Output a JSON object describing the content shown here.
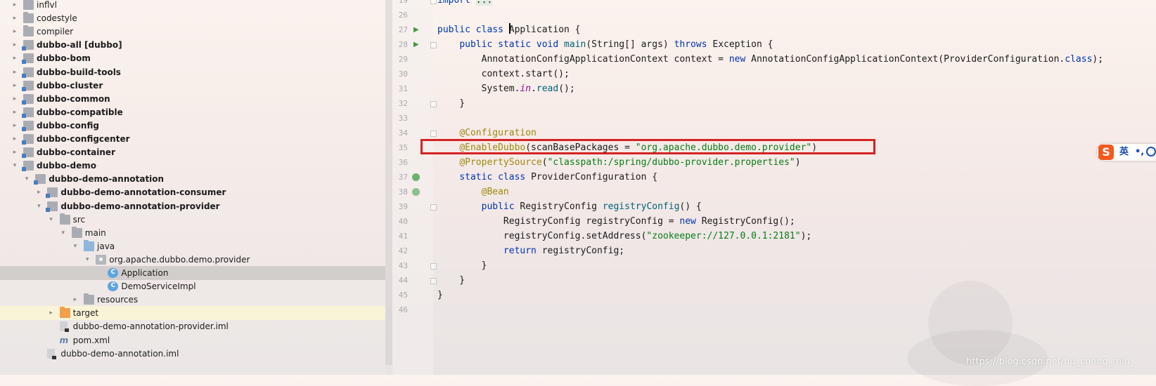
{
  "tree": {
    "rows": [
      {
        "indent": 1,
        "arrow": "▸",
        "icon": "folder",
        "label": "inflvl",
        "bold": false
      },
      {
        "indent": 1,
        "arrow": "▸",
        "icon": "folder",
        "label": "codestyle",
        "bold": false
      },
      {
        "indent": 1,
        "arrow": "▸",
        "icon": "folder",
        "label": "compiler",
        "bold": false
      },
      {
        "indent": 1,
        "arrow": "▸",
        "icon": "module",
        "label": "dubbo-all",
        "suffix": "[dubbo]",
        "bold": true
      },
      {
        "indent": 1,
        "arrow": "▸",
        "icon": "module",
        "label": "dubbo-bom",
        "bold": true
      },
      {
        "indent": 1,
        "arrow": "▸",
        "icon": "module",
        "label": "dubbo-build-tools",
        "bold": true
      },
      {
        "indent": 1,
        "arrow": "▸",
        "icon": "module",
        "label": "dubbo-cluster",
        "bold": true
      },
      {
        "indent": 1,
        "arrow": "▸",
        "icon": "module",
        "label": "dubbo-common",
        "bold": true
      },
      {
        "indent": 1,
        "arrow": "▸",
        "icon": "module",
        "label": "dubbo-compatible",
        "bold": true
      },
      {
        "indent": 1,
        "arrow": "▸",
        "icon": "module",
        "label": "dubbo-config",
        "bold": true
      },
      {
        "indent": 1,
        "arrow": "▸",
        "icon": "module",
        "label": "dubbo-configcenter",
        "bold": true
      },
      {
        "indent": 1,
        "arrow": "▸",
        "icon": "module",
        "label": "dubbo-container",
        "bold": true
      },
      {
        "indent": 1,
        "arrow": "▾",
        "icon": "module",
        "label": "dubbo-demo",
        "bold": true
      },
      {
        "indent": 2,
        "arrow": "▾",
        "icon": "module",
        "label": "dubbo-demo-annotation",
        "bold": true
      },
      {
        "indent": 3,
        "arrow": "▸",
        "icon": "module",
        "label": "dubbo-demo-annotation-consumer",
        "bold": true
      },
      {
        "indent": 3,
        "arrow": "▾",
        "icon": "module",
        "label": "dubbo-demo-annotation-provider",
        "bold": true
      },
      {
        "indent": 4,
        "arrow": "▾",
        "icon": "folder",
        "label": "src",
        "bold": false
      },
      {
        "indent": 5,
        "arrow": "▾",
        "icon": "folder",
        "label": "main",
        "bold": false
      },
      {
        "indent": 6,
        "arrow": "▾",
        "icon": "src-folder",
        "label": "java",
        "bold": false
      },
      {
        "indent": 7,
        "arrow": "▾",
        "icon": "package",
        "label": "org.apache.dubbo.demo.provider",
        "bold": false
      },
      {
        "indent": 8,
        "arrow": "",
        "icon": "class",
        "label": "Application",
        "bold": false,
        "selected": true
      },
      {
        "indent": 8,
        "arrow": "",
        "icon": "class",
        "label": "DemoServiceImpl",
        "bold": false
      },
      {
        "indent": 6,
        "arrow": "▸",
        "icon": "res-folder",
        "label": "resources",
        "bold": false
      },
      {
        "indent": 4,
        "arrow": "▸",
        "icon": "orange-folder",
        "label": "target",
        "bold": false,
        "target": true
      },
      {
        "indent": 4,
        "arrow": "",
        "icon": "iml",
        "label": "dubbo-demo-annotation-provider.iml",
        "bold": false
      },
      {
        "indent": 4,
        "arrow": "",
        "icon": "maven",
        "label": "pom.xml",
        "bold": false
      },
      {
        "indent": 3,
        "arrow": "",
        "icon": "iml",
        "label": "dubbo-demo-annotation.iml",
        "bold": false
      }
    ]
  },
  "editor": {
    "lines": [
      {
        "n": "19",
        "fold": true,
        "segs": [
          [
            "kw",
            "import "
          ],
          [
            "pill",
            "..."
          ]
        ]
      },
      {
        "n": "26",
        "segs": []
      },
      {
        "n": "27",
        "run": true,
        "segs": [
          [
            "kw",
            "public class "
          ],
          [
            "caret",
            ""
          ],
          [
            "",
            "Application {"
          ]
        ]
      },
      {
        "n": "28",
        "run": true,
        "fold": true,
        "segs": [
          [
            "",
            "    "
          ],
          [
            "kw",
            "public static void "
          ],
          [
            "mt",
            "main"
          ],
          [
            "",
            "(String[] args) "
          ],
          [
            "kw",
            "throws "
          ],
          [
            "",
            "Exception {"
          ]
        ]
      },
      {
        "n": "29",
        "segs": [
          [
            "",
            "        AnnotationConfigApplicationContext context = "
          ],
          [
            "kw",
            "new "
          ],
          [
            "",
            "AnnotationConfigApplicationContext(ProviderConfiguration."
          ],
          [
            "kw",
            "class"
          ],
          [
            "",
            ");"
          ]
        ]
      },
      {
        "n": "30",
        "segs": [
          [
            "",
            "        context.start();"
          ]
        ]
      },
      {
        "n": "31",
        "segs": [
          [
            "",
            "        System."
          ],
          [
            "it",
            "in"
          ],
          [
            "",
            "."
          ],
          [
            "mt",
            "read"
          ],
          [
            "",
            "();"
          ]
        ]
      },
      {
        "n": "32",
        "fold": true,
        "segs": [
          [
            "",
            "    }"
          ]
        ]
      },
      {
        "n": "33",
        "segs": []
      },
      {
        "n": "34",
        "fold": true,
        "segs": [
          [
            "",
            "    "
          ],
          [
            "an",
            "@Configuration"
          ]
        ]
      },
      {
        "n": "35",
        "segs": [
          [
            "",
            "    "
          ],
          [
            "an",
            "@EnableDubbo"
          ],
          [
            "",
            "(scanBasePackages = "
          ],
          [
            "st",
            "\"org.apache.dubbo.demo.provider\""
          ],
          [
            "",
            ")"
          ]
        ]
      },
      {
        "n": "36",
        "segs": [
          [
            "",
            "    "
          ],
          [
            "an",
            "@PropertySource"
          ],
          [
            "",
            "("
          ],
          [
            "st",
            "\"classpath:/spring/dubbo-provider.properties\""
          ],
          [
            "",
            ")"
          ]
        ]
      },
      {
        "n": "37",
        "bean": true,
        "segs": [
          [
            "",
            "    "
          ],
          [
            "kw",
            "static class "
          ],
          [
            "",
            "ProviderConfiguration {"
          ]
        ]
      },
      {
        "n": "38",
        "leaf": true,
        "segs": [
          [
            "",
            "        "
          ],
          [
            "an",
            "@Bean"
          ]
        ]
      },
      {
        "n": "39",
        "fold": true,
        "segs": [
          [
            "",
            "        "
          ],
          [
            "kw",
            "public "
          ],
          [
            "",
            "RegistryConfig "
          ],
          [
            "mt",
            "registryConfig"
          ],
          [
            "",
            "() {"
          ]
        ]
      },
      {
        "n": "40",
        "segs": [
          [
            "",
            "            RegistryConfig registryConfig = "
          ],
          [
            "kw",
            "new "
          ],
          [
            "",
            "RegistryConfig();"
          ]
        ]
      },
      {
        "n": "41",
        "segs": [
          [
            "",
            "            registryConfig.setAddress("
          ],
          [
            "st",
            "\"zookeeper://127.0.0.1:2181\""
          ],
          [
            "",
            ");"
          ]
        ]
      },
      {
        "n": "42",
        "segs": [
          [
            "",
            "            "
          ],
          [
            "kw",
            "return "
          ],
          [
            "",
            "registryConfig;"
          ]
        ]
      },
      {
        "n": "43",
        "fold": true,
        "segs": [
          [
            "",
            "        }"
          ]
        ]
      },
      {
        "n": "44",
        "fold": true,
        "segs": [
          [
            "",
            "    }"
          ]
        ]
      },
      {
        "n": "45",
        "segs": [
          [
            "",
            "}"
          ]
        ]
      },
      {
        "n": "46",
        "segs": []
      }
    ]
  },
  "ime": {
    "logo": "S",
    "lang": "英",
    "punct": "•,"
  },
  "watermark": "https://blog.csdn.net/hu_cheng_min_",
  "colors": {
    "keyword": "#0033b3",
    "annotation": "#9e880d",
    "string": "#067d17",
    "highlight_box": "#d42323"
  }
}
